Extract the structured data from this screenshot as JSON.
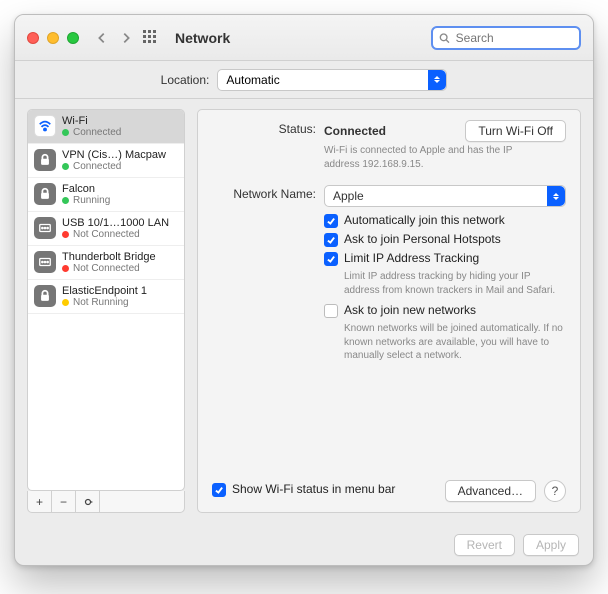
{
  "header": {
    "title": "Network",
    "search_placeholder": "Search"
  },
  "location": {
    "label": "Location:",
    "value": "Automatic"
  },
  "sidebar": {
    "items": [
      {
        "name": "Wi-Fi",
        "status": "Connected",
        "dot": "green"
      },
      {
        "name": "VPN (Cis…) Macpaw",
        "status": "Connected",
        "dot": "green"
      },
      {
        "name": "Falcon",
        "status": "Running",
        "dot": "green"
      },
      {
        "name": "USB 10/1…1000 LAN",
        "status": "Not Connected",
        "dot": "red"
      },
      {
        "name": "Thunderbolt Bridge",
        "status": "Not Connected",
        "dot": "red"
      },
      {
        "name": "ElasticEndpoint 1",
        "status": "Not Running",
        "dot": "yellow"
      }
    ]
  },
  "main": {
    "status_label": "Status:",
    "status_value": "Connected",
    "wifi_toggle": "Turn Wi-Fi Off",
    "status_hint": "Wi-Fi is connected to Apple and has the IP address 192.168.9.15.",
    "network_label": "Network Name:",
    "network_value": "Apple",
    "opt_auto": "Automatically join this network",
    "opt_hotspot": "Ask to join Personal Hotspots",
    "opt_limitip": "Limit IP Address Tracking",
    "limitip_hint": "Limit IP address tracking by hiding your IP address from known trackers in Mail and Safari.",
    "opt_joinnew": "Ask to join new networks",
    "joinnew_hint": "Known networks will be joined automatically. If no known networks are available, you will have to manually select a network.",
    "menubar": "Show Wi-Fi status in menu bar",
    "advanced": "Advanced…",
    "help": "?"
  },
  "footer": {
    "revert": "Revert",
    "apply": "Apply"
  },
  "listctl": {
    "plus": "+",
    "minus": "−"
  }
}
